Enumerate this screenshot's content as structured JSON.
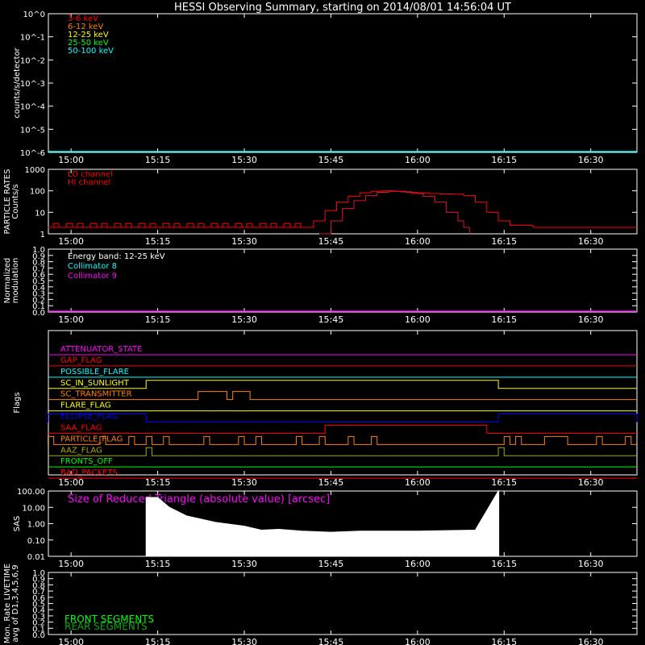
{
  "title": "HESSI Observing Summary, starting on 2014/08/01 14:56:04 UT",
  "colors": {
    "background": "#000000",
    "axes": "#ffffff",
    "cyan": "#00ffff",
    "red": "#ff0000",
    "crimson": "#dd1040",
    "magenta": "#ff00ff",
    "orange": "#ff8000",
    "yellow": "#ffff00",
    "green": "#00ff00",
    "blue": "#0000ff",
    "olive": "#aaaa00"
  },
  "time_axis": {
    "start": "14:56:04",
    "end": "16:38",
    "start_min": 896.07,
    "end_min": 998,
    "ticks": [
      {
        "min": 900,
        "label": "15:00"
      },
      {
        "min": 915,
        "label": "15:15"
      },
      {
        "min": 930,
        "label": "15:30"
      },
      {
        "min": 945,
        "label": "15:45"
      },
      {
        "min": 960,
        "label": "16:00"
      },
      {
        "min": 975,
        "label": "16:15"
      },
      {
        "min": 990,
        "label": "16:30"
      }
    ]
  },
  "chart_data": [
    {
      "type": "line",
      "name": "spectrum",
      "ylabel": "counts/s/detector",
      "yscale": "log",
      "ylim": [
        1,
        100000
      ],
      "yticklabels": [
        "10^0",
        "10^-1",
        "10^-2",
        "10^-3",
        "10^-4",
        "10^-5",
        "10^-6"
      ],
      "legend": [
        {
          "label": "3-6 keV",
          "color": "#ff0000"
        },
        {
          "label": "6-12 keV",
          "color": "#ff8000"
        },
        {
          "label": "12-25 keV",
          "color": "#ffff00"
        },
        {
          "label": "25-50 keV",
          "color": "#00ff00"
        },
        {
          "label": "50-100 keV",
          "color": "#00ffff"
        }
      ],
      "series": [
        {
          "label": "50-100 keV",
          "color": "#00ffff",
          "x": [
            "14:56",
            "16:38"
          ],
          "y": [
            1,
            1
          ]
        }
      ]
    },
    {
      "type": "line",
      "name": "particle-rates",
      "ylabel": "PARTICLE RATES Counts/s",
      "yscale": "log",
      "ylim": [
        1,
        1000
      ],
      "yticklabels": [
        "1000",
        "100",
        "10",
        "1"
      ],
      "legend": [
        {
          "label": "LO channel",
          "color": "#ff0000"
        },
        {
          "label": "HI channel",
          "color": "#ff0000"
        }
      ],
      "series": [
        {
          "label": "LO channel",
          "color": "#ff0000",
          "x": [
            "14:56",
            "15:40",
            "15:42",
            "15:44",
            "15:46",
            "15:48",
            "15:50",
            "15:52",
            "15:54",
            "15:56",
            "15:58",
            "16:00",
            "16:02",
            "16:04",
            "16:06",
            "16:08",
            "16:10",
            "16:12",
            "16:14",
            "16:16",
            "16:20",
            "16:38"
          ],
          "y": [
            2,
            2,
            4,
            12,
            30,
            55,
            80,
            95,
            100,
            95,
            85,
            80,
            75,
            72,
            70,
            60,
            30,
            10,
            4,
            2.5,
            2,
            2
          ]
        },
        {
          "label": "HI channel",
          "color": "#dd1040",
          "x": [
            "15:43",
            "15:45",
            "15:47",
            "15:49",
            "15:51",
            "15:53",
            "15:55",
            "15:57",
            "15:59",
            "16:01",
            "16:03",
            "16:05",
            "16:07",
            "16:08",
            "16:09"
          ],
          "y": [
            1,
            4,
            15,
            35,
            60,
            85,
            95,
            90,
            75,
            55,
            30,
            10,
            4,
            2,
            1
          ]
        }
      ]
    },
    {
      "type": "line",
      "name": "modulation",
      "ylabel": "Normalized modulation",
      "ylim": [
        0,
        1
      ],
      "yticklabels": [
        "0.0",
        "0.1",
        "0.2",
        "0.3",
        "0.4",
        "0.5",
        "0.6",
        "0.7",
        "0.8",
        "0.9",
        "1.0"
      ],
      "legend": [
        {
          "label": "Energy band: 12-25 keV",
          "color": "#ffffff"
        },
        {
          "label": "Collimator 8",
          "color": "#00ffff"
        },
        {
          "label": "Collimator 9",
          "color": "#ff00ff"
        }
      ],
      "series": [
        {
          "label": "Collimator 9",
          "color": "#ff00ff",
          "x": [
            "14:56",
            "16:38"
          ],
          "y": [
            0,
            0
          ]
        }
      ]
    },
    {
      "type": "line",
      "name": "flags",
      "ylabel": "Flags",
      "flags": [
        {
          "label": "ATTENUATOR_STATE",
          "color": "#ff00ff",
          "on": []
        },
        {
          "label": "GAP_FLAG",
          "color": "#ff0000",
          "on": []
        },
        {
          "label": "POSSIBLE_FLARE",
          "color": "#00ffff",
          "on": []
        },
        {
          "label": "SC_IN_SUNLIGHT",
          "color": "#ffff00",
          "on": [
            [
              "15:13",
              "16:14"
            ]
          ]
        },
        {
          "label": "SC_TRANSMITTER",
          "color": "#ff8000",
          "on": [
            [
              "15:22",
              "15:27"
            ],
            [
              "15:28",
              "15:31"
            ]
          ]
        },
        {
          "label": "FLARE_FLAG",
          "color": "#ffff00",
          "on": []
        },
        {
          "label": "ECLIPSE_FLAG",
          "color": "#0000ff",
          "on": [
            [
              "14:56",
              "15:13"
            ],
            [
              "16:14",
              "16:38"
            ]
          ]
        },
        {
          "label": "SAA_FLAG",
          "color": "#ff0000",
          "on": [
            [
              "15:44",
              "16:12"
            ]
          ]
        },
        {
          "label": "PARTICLE_FLAG",
          "color": "#ff8000",
          "on": [
            [
              "14:56",
              "14:57"
            ],
            [
              "15:05",
              "15:06"
            ],
            [
              "15:10",
              "15:11"
            ],
            [
              "15:13",
              "15:14"
            ],
            [
              "15:16",
              "15:17"
            ],
            [
              "15:23",
              "15:24"
            ],
            [
              "15:29",
              "15:30"
            ],
            [
              "15:32",
              "15:33"
            ],
            [
              "15:39",
              "15:40"
            ],
            [
              "15:43",
              "15:44"
            ],
            [
              "15:48",
              "15:49"
            ],
            [
              "15:52",
              "15:53"
            ],
            [
              "16:15",
              "16:16"
            ],
            [
              "16:17",
              "16:18"
            ],
            [
              "16:22",
              "16:26"
            ],
            [
              "16:31",
              "16:32"
            ],
            [
              "16:36",
              "16:37"
            ]
          ]
        },
        {
          "label": "AAZ_FLAG",
          "color": "#aaaa00",
          "on": [
            [
              "15:13",
              "15:14"
            ],
            [
              "16:14",
              "16:15"
            ]
          ]
        },
        {
          "label": "FRONTS_OFF",
          "color": "#00ff00",
          "on": []
        },
        {
          "label": "BAD_PACKETS",
          "color": "#ff0000",
          "on": []
        }
      ]
    },
    {
      "type": "area",
      "name": "sas",
      "ylabel": "SAS",
      "yscale": "log",
      "ylim": [
        0.01,
        100
      ],
      "yticklabels": [
        "100.00",
        "10.00",
        "1.00",
        "0.10",
        "0.01"
      ],
      "annotation": "Size of Reduced Triangle (absolute value) [arcsec]",
      "annotation_color": "#ff00ff",
      "series": [
        {
          "color": "#ffffff",
          "x": [
            "15:13",
            "15:15",
            "15:17",
            "15:20",
            "15:25",
            "15:30",
            "15:33",
            "15:36",
            "15:40",
            "15:45",
            "15:50",
            "16:00",
            "16:10",
            "16:14"
          ],
          "y_max": [
            40,
            40,
            10,
            3,
            1.2,
            0.7,
            0.4,
            0.45,
            0.35,
            0.3,
            0.35,
            0.35,
            0.4,
            100
          ]
        }
      ]
    },
    {
      "type": "line",
      "name": "livetime",
      "ylabel": "Mon. Rate LIVETIME avg of D1,3,4,5,6,9",
      "ylim": [
        0,
        1
      ],
      "yticklabels": [
        "0.0",
        "0.1",
        "0.2",
        "0.3",
        "0.4",
        "0.5",
        "0.6",
        "0.7",
        "0.8",
        "0.9",
        "1.0"
      ],
      "legend": [
        {
          "label": "FRONT SEGMENTS",
          "color": "#00ff00"
        },
        {
          "label": "REAR SEGMENTS",
          "color": "#00aa00"
        }
      ]
    }
  ]
}
